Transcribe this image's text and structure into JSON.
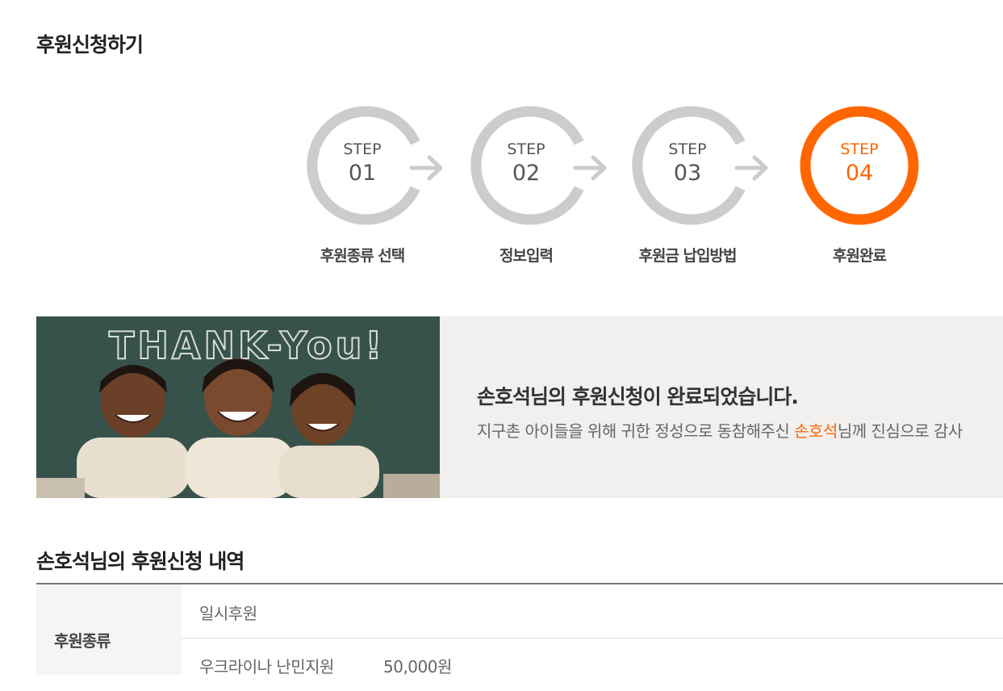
{
  "page_title": "후원신청하기",
  "steps": [
    {
      "word": "STEP",
      "num": "01",
      "label": "후원종류 선택",
      "active": false
    },
    {
      "word": "STEP",
      "num": "02",
      "label": "정보입력",
      "active": false
    },
    {
      "word": "STEP",
      "num": "03",
      "label": "후원금 납입방법",
      "active": false
    },
    {
      "word": "STEP",
      "num": "04",
      "label": "후원완료",
      "active": true
    }
  ],
  "colors": {
    "active": "#ff6600",
    "inactive": "#cccccc"
  },
  "banner": {
    "photo_text": "THANK-You!",
    "title": "손호석님의 후원신청이 완료되었습니다.",
    "msg_before": "지구촌 아이들을 위해 귀한 정성으로 동참해주신 ",
    "msg_name": "손호석",
    "msg_after": "님께 진심으로 감사"
  },
  "details": {
    "title": "손호석님의 후원신청 내역",
    "type_label": "후원종류",
    "type_value": "일시후원",
    "campaign": "우크라이나 난민지원",
    "amount": "50,000원"
  }
}
